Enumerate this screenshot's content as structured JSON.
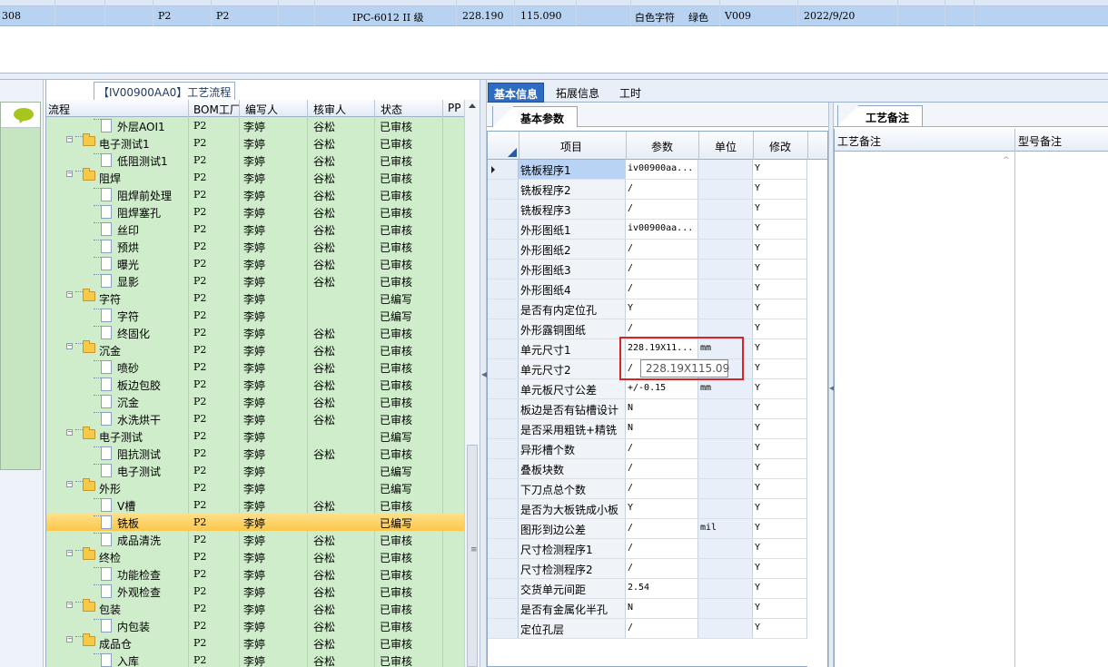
{
  "top_grid": {
    "row": [
      "308",
      "P2",
      "P2",
      "IPC-6012 II 级",
      "228.190",
      "115.090",
      "白色字符",
      "绿色",
      "V009",
      "2022/9/20"
    ]
  },
  "tree": {
    "title": "【IV00900AA0】工艺流程",
    "columns": [
      "流程",
      "BOM工厂",
      "编写人",
      "核审人",
      "状态",
      "PP"
    ],
    "rows": [
      {
        "name": "外层AOI1",
        "bom": "P2",
        "writer": "李婷",
        "reviewer": "谷松",
        "status": "已审核",
        "kind": "doc",
        "level": 2
      },
      {
        "name": "电子测试1",
        "bom": "P2",
        "writer": "李婷",
        "reviewer": "谷松",
        "status": "已审核",
        "kind": "folder",
        "level": 1
      },
      {
        "name": "低阻测试1",
        "bom": "P2",
        "writer": "李婷",
        "reviewer": "谷松",
        "status": "已审核",
        "kind": "doc",
        "level": 2
      },
      {
        "name": "阻焊",
        "bom": "P2",
        "writer": "李婷",
        "reviewer": "谷松",
        "status": "已审核",
        "kind": "folder",
        "level": 1
      },
      {
        "name": "阻焊前处理",
        "bom": "P2",
        "writer": "李婷",
        "reviewer": "谷松",
        "status": "已审核",
        "kind": "doc",
        "level": 2
      },
      {
        "name": "阻焊塞孔",
        "bom": "P2",
        "writer": "李婷",
        "reviewer": "谷松",
        "status": "已审核",
        "kind": "doc",
        "level": 2
      },
      {
        "name": "丝印",
        "bom": "P2",
        "writer": "李婷",
        "reviewer": "谷松",
        "status": "已审核",
        "kind": "doc",
        "level": 2
      },
      {
        "name": "预烘",
        "bom": "P2",
        "writer": "李婷",
        "reviewer": "谷松",
        "status": "已审核",
        "kind": "doc",
        "level": 2
      },
      {
        "name": "曝光",
        "bom": "P2",
        "writer": "李婷",
        "reviewer": "谷松",
        "status": "已审核",
        "kind": "doc",
        "level": 2
      },
      {
        "name": "显影",
        "bom": "P2",
        "writer": "李婷",
        "reviewer": "谷松",
        "status": "已审核",
        "kind": "doc",
        "level": 2
      },
      {
        "name": "字符",
        "bom": "P2",
        "writer": "李婷",
        "reviewer": "",
        "status": "已编写",
        "kind": "folder",
        "level": 1
      },
      {
        "name": "字符",
        "bom": "P2",
        "writer": "李婷",
        "reviewer": "",
        "status": "已编写",
        "kind": "doc",
        "level": 2
      },
      {
        "name": "终固化",
        "bom": "P2",
        "writer": "李婷",
        "reviewer": "谷松",
        "status": "已审核",
        "kind": "doc",
        "level": 2
      },
      {
        "name": "沉金",
        "bom": "P2",
        "writer": "李婷",
        "reviewer": "谷松",
        "status": "已审核",
        "kind": "folder",
        "level": 1
      },
      {
        "name": "喷砂",
        "bom": "P2",
        "writer": "李婷",
        "reviewer": "谷松",
        "status": "已审核",
        "kind": "doc",
        "level": 2
      },
      {
        "name": "板边包胶",
        "bom": "P2",
        "writer": "李婷",
        "reviewer": "谷松",
        "status": "已审核",
        "kind": "doc",
        "level": 2
      },
      {
        "name": "沉金",
        "bom": "P2",
        "writer": "李婷",
        "reviewer": "谷松",
        "status": "已审核",
        "kind": "doc",
        "level": 2
      },
      {
        "name": "水洗烘干",
        "bom": "P2",
        "writer": "李婷",
        "reviewer": "谷松",
        "status": "已审核",
        "kind": "doc",
        "level": 2
      },
      {
        "name": "电子测试",
        "bom": "P2",
        "writer": "李婷",
        "reviewer": "",
        "status": "已编写",
        "kind": "folder",
        "level": 1
      },
      {
        "name": "阻抗测试",
        "bom": "P2",
        "writer": "李婷",
        "reviewer": "谷松",
        "status": "已审核",
        "kind": "doc",
        "level": 2
      },
      {
        "name": "电子测试",
        "bom": "P2",
        "writer": "李婷",
        "reviewer": "",
        "status": "已编写",
        "kind": "doc",
        "level": 2
      },
      {
        "name": "外形",
        "bom": "P2",
        "writer": "李婷",
        "reviewer": "",
        "status": "已编写",
        "kind": "folder",
        "level": 1
      },
      {
        "name": "V槽",
        "bom": "P2",
        "writer": "李婷",
        "reviewer": "谷松",
        "status": "已审核",
        "kind": "doc",
        "level": 2
      },
      {
        "name": "铣板",
        "bom": "P2",
        "writer": "李婷",
        "reviewer": "",
        "status": "已编写",
        "kind": "doc",
        "level": 2,
        "selected": true
      },
      {
        "name": "成品清洗",
        "bom": "P2",
        "writer": "李婷",
        "reviewer": "谷松",
        "status": "已审核",
        "kind": "doc",
        "level": 2
      },
      {
        "name": "终检",
        "bom": "P2",
        "writer": "李婷",
        "reviewer": "谷松",
        "status": "已审核",
        "kind": "folder",
        "level": 1
      },
      {
        "name": "功能检查",
        "bom": "P2",
        "writer": "李婷",
        "reviewer": "谷松",
        "status": "已审核",
        "kind": "doc",
        "level": 2
      },
      {
        "name": "外观检查",
        "bom": "P2",
        "writer": "李婷",
        "reviewer": "谷松",
        "status": "已审核",
        "kind": "doc",
        "level": 2
      },
      {
        "name": "包装",
        "bom": "P2",
        "writer": "李婷",
        "reviewer": "谷松",
        "status": "已审核",
        "kind": "folder",
        "level": 1
      },
      {
        "name": "内包装",
        "bom": "P2",
        "writer": "李婷",
        "reviewer": "谷松",
        "status": "已审核",
        "kind": "doc",
        "level": 2
      },
      {
        "name": "成品仓",
        "bom": "P2",
        "writer": "李婷",
        "reviewer": "谷松",
        "status": "已审核",
        "kind": "folder",
        "level": 1
      },
      {
        "name": "入库",
        "bom": "P2",
        "writer": "李婷",
        "reviewer": "谷松",
        "status": "已审核",
        "kind": "doc",
        "level": 2
      }
    ]
  },
  "tabs": {
    "main": [
      "基本信息",
      "拓展信息",
      "工时"
    ],
    "active_main": "基本信息",
    "sub": "基本参数",
    "notes": "工艺备注"
  },
  "params": {
    "columns": [
      "项目",
      "参数",
      "单位",
      "修改"
    ],
    "rows": [
      {
        "item": "铣板程序1",
        "value": "iv00900aa...",
        "unit": "",
        "mod": "Y",
        "current": true
      },
      {
        "item": "铣板程序2",
        "value": "/",
        "unit": "",
        "mod": "Y"
      },
      {
        "item": "铣板程序3",
        "value": "/",
        "unit": "",
        "mod": "Y"
      },
      {
        "item": "外形图纸1",
        "value": "iv00900aa...",
        "unit": "",
        "mod": "Y"
      },
      {
        "item": "外形图纸2",
        "value": "/",
        "unit": "",
        "mod": "Y"
      },
      {
        "item": "外形图纸3",
        "value": "/",
        "unit": "",
        "mod": "Y"
      },
      {
        "item": "外形图纸4",
        "value": "/",
        "unit": "",
        "mod": "Y"
      },
      {
        "item": "是否有内定位孔",
        "value": "Y",
        "unit": "",
        "mod": "Y"
      },
      {
        "item": "外形露铜图纸",
        "value": "/",
        "unit": "",
        "mod": "Y"
      },
      {
        "item": "单元尺寸1",
        "value": "228.19X11...",
        "unit": "mm",
        "mod": "Y"
      },
      {
        "item": "单元尺寸2",
        "value": "/",
        "unit": "",
        "mod": "Y"
      },
      {
        "item": "单元板尺寸公差",
        "value": "+/-0.15",
        "unit": "mm",
        "mod": "Y"
      },
      {
        "item": "板边是否有钻槽设计",
        "value": "N",
        "unit": "",
        "mod": "Y"
      },
      {
        "item": "是否采用粗铣+精铣",
        "value": "N",
        "unit": "",
        "mod": "Y"
      },
      {
        "item": "异形槽个数",
        "value": "/",
        "unit": "",
        "mod": "Y"
      },
      {
        "item": "叠板块数",
        "value": "/",
        "unit": "",
        "mod": "Y"
      },
      {
        "item": "下刀点总个数",
        "value": "/",
        "unit": "",
        "mod": "Y"
      },
      {
        "item": "是否为大板铣成小板",
        "value": "Y",
        "unit": "",
        "mod": "Y"
      },
      {
        "item": "图形到边公差",
        "value": "/",
        "unit": "mil",
        "mod": "Y"
      },
      {
        "item": "尺寸检测程序1",
        "value": "/",
        "unit": "",
        "mod": "Y"
      },
      {
        "item": "尺寸检测程序2",
        "value": "/",
        "unit": "",
        "mod": "Y"
      },
      {
        "item": "交货单元间距",
        "value": "2.54",
        "unit": "",
        "mod": "Y"
      },
      {
        "item": "是否有金属化半孔",
        "value": "N",
        "unit": "",
        "mod": "Y"
      },
      {
        "item": "定位孔层",
        "value": "/",
        "unit": "",
        "mod": "Y"
      }
    ],
    "tooltip": "228.19X115.09"
  },
  "notes": {
    "columns": [
      "工艺备注",
      "型号备注"
    ]
  },
  "colors": {
    "tree_bg": "#cfeccb",
    "selected_row": "#fbc74b",
    "active_tab": "#2d6cc0",
    "highlight": "#d9232a"
  }
}
